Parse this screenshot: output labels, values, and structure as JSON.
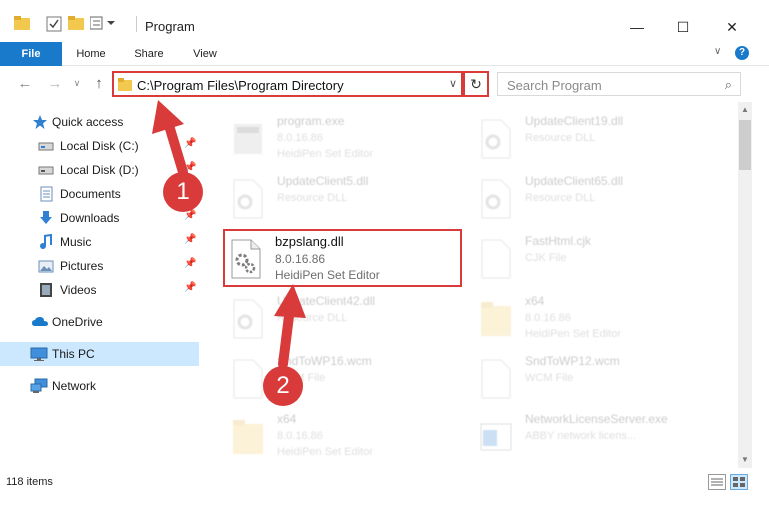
{
  "window": {
    "title": "Program",
    "minimize": "—",
    "maximize": "☐",
    "close": "✕"
  },
  "ribbon": {
    "tabs": [
      "File",
      "Home",
      "Share",
      "View"
    ],
    "help": "?"
  },
  "addressbar": {
    "path": "C:\\Program Files\\Program Directory",
    "search_placeholder": "Search Program"
  },
  "nav": {
    "items": [
      {
        "label": "Quick access",
        "icon": "star-icon"
      },
      {
        "label": "Local Disk (C:)",
        "icon": "drive-icon",
        "pinned": true
      },
      {
        "label": "Local Disk (D:)",
        "icon": "drive-icon",
        "pinned": true
      },
      {
        "label": "Documents",
        "icon": "documents-icon",
        "pinned": true
      },
      {
        "label": "Downloads",
        "icon": "download-icon",
        "pinned": true
      },
      {
        "label": "Music",
        "icon": "music-icon",
        "pinned": true
      },
      {
        "label": "Pictures",
        "icon": "pictures-icon",
        "pinned": true
      },
      {
        "label": "Videos",
        "icon": "video-icon",
        "pinned": true
      },
      {
        "label": "OneDrive",
        "icon": "cloud-icon"
      },
      {
        "label": "This PC",
        "icon": "monitor-icon",
        "selected": true
      },
      {
        "label": "Network",
        "icon": "network-icon"
      }
    ]
  },
  "files": [
    {
      "name": "program.exe",
      "sub1": "8.0.16.86",
      "sub2": "HeidiPen Set Editor",
      "kind": "exe"
    },
    {
      "name": "UpdateClient19.dll",
      "sub1": "Resource DLL",
      "sub2": "",
      "kind": "dll"
    },
    {
      "name": "UpdateClient5.dll",
      "sub1": "Resource DLL",
      "sub2": "",
      "kind": "dll"
    },
    {
      "name": "UpdateClient65.dll",
      "sub1": "Resource DLL",
      "sub2": "",
      "kind": "dll"
    },
    {
      "name": "bzpslang.dll",
      "sub1": "8.0.16.86",
      "sub2": "HeidiPen Set Editor",
      "kind": "dll",
      "highlight": true
    },
    {
      "name": "FastHtml.cjk",
      "sub1": "CJK File",
      "sub2": "",
      "kind": "file"
    },
    {
      "name": "UpdateClient42.dll",
      "sub1": "Resource DLL",
      "sub2": "",
      "kind": "dll"
    },
    {
      "name": "x64",
      "sub1": "8.0.16.86",
      "sub2": "HeidiPen Set Editor",
      "kind": "folder"
    },
    {
      "name": "SndToWP16.wcm",
      "sub1": "WCM File",
      "sub2": "",
      "kind": "file"
    },
    {
      "name": "SndToWP12.wcm",
      "sub1": "WCM File",
      "sub2": "",
      "kind": "file"
    },
    {
      "name": "x64",
      "sub1": "8.0.16.86",
      "sub2": "HeidiPen Set Editor",
      "kind": "folder"
    },
    {
      "name": "NetworkLicenseServer.exe",
      "sub1": "ABBY network licens...",
      "sub2": "",
      "kind": "exe2"
    }
  ],
  "status": {
    "item_count": "118 items"
  },
  "annotations": {
    "step1": "1",
    "step2": "2",
    "accent": "#d93a3a"
  }
}
